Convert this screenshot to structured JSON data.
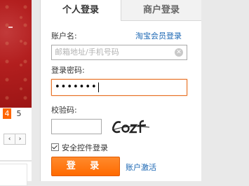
{
  "tabs": {
    "personal": "个人登录",
    "merchant": "商户登录"
  },
  "account": {
    "label": "账户名:",
    "placeholder": "邮箱地址/手机号码",
    "member_link": "淘宝会员登录"
  },
  "password": {
    "label": "登录密码:",
    "masked_value": "•••••••"
  },
  "captcha": {
    "label": "校验码:",
    "image_text": "Cozf"
  },
  "safe_control": {
    "label": "安全控件登录",
    "checked": true
  },
  "login_button": "登 录",
  "activate_link": "账户激活",
  "pager": {
    "current": "4",
    "next": "5"
  },
  "arrows": {
    "prev": "‹",
    "next": "›"
  },
  "colors": {
    "accent": "#ff6600",
    "link": "#1a66b3",
    "banner": "#b31f1f"
  }
}
